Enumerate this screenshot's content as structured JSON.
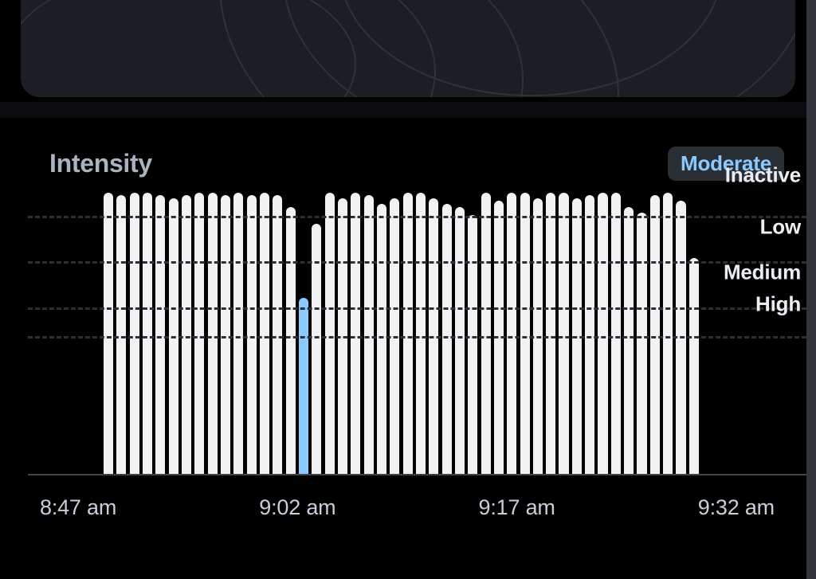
{
  "hero": {},
  "chart": {
    "title": "Intensity",
    "summary_badge": "Moderate"
  },
  "chart_data": {
    "type": "bar",
    "title": "Intensity",
    "xlabel": "",
    "ylabel": "",
    "x_ticks": [
      "8:47 am",
      "9:02 am",
      "9:17 am",
      "9:32 am"
    ],
    "y_categories_top_to_bottom": [
      "High",
      "Medium",
      "Low",
      "Inactive"
    ],
    "ylim": [
      0,
      100
    ],
    "gridline_levels": [
      48,
      58,
      74,
      90
    ],
    "y_label_levels": {
      "High": 55,
      "Medium": 66,
      "Low": 82,
      "Inactive": 100
    },
    "start_time": "8:47 am",
    "end_time": "9:32 am",
    "series": [
      {
        "name": "intensity",
        "values_pct": [
          99,
          98,
          99,
          99,
          98,
          97,
          98,
          99,
          99,
          98,
          99,
          98,
          99,
          98,
          94,
          62,
          88,
          99,
          97,
          99,
          98,
          95,
          97,
          99,
          99,
          97,
          95,
          94,
          91,
          99,
          96,
          99,
          99,
          97,
          99,
          99,
          97,
          98,
          99,
          99,
          94,
          92,
          98,
          99,
          96,
          76
        ],
        "highlight_index": 15
      }
    ]
  }
}
